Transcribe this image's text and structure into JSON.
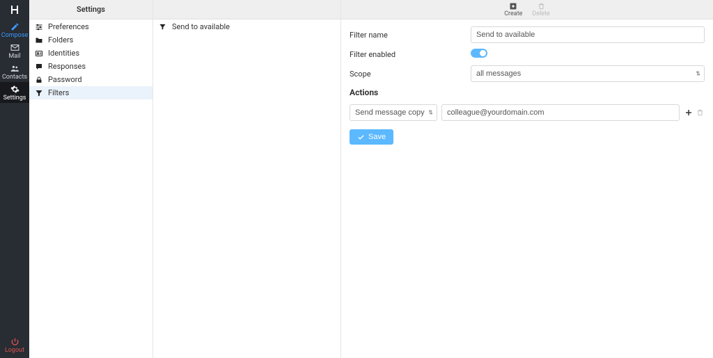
{
  "taskbar": {
    "items": [
      {
        "label": "Compose",
        "icon": "compose-icon"
      },
      {
        "label": "Mail",
        "icon": "mail-icon"
      },
      {
        "label": "Contacts",
        "icon": "contacts-icon"
      },
      {
        "label": "Settings",
        "icon": "gear-icon"
      }
    ],
    "logout_label": "Logout"
  },
  "settings": {
    "header": "Settings",
    "items": [
      {
        "label": "Preferences"
      },
      {
        "label": "Folders"
      },
      {
        "label": "Identities"
      },
      {
        "label": "Responses"
      },
      {
        "label": "Password"
      },
      {
        "label": "Filters"
      }
    ]
  },
  "filters_list": {
    "items": [
      {
        "label": "Send to available"
      }
    ]
  },
  "toolbar": {
    "create_label": "Create",
    "delete_label": "Delete"
  },
  "form": {
    "filter_name_label": "Filter name",
    "filter_name_value": "Send to available",
    "filter_enabled_label": "Filter enabled",
    "filter_enabled_value": true,
    "scope_label": "Scope",
    "scope_value": "all messages",
    "actions_heading": "Actions",
    "action_type_value": "Send message copy to",
    "action_target_value": "colleague@yourdomain.com",
    "save_label": "Save"
  }
}
